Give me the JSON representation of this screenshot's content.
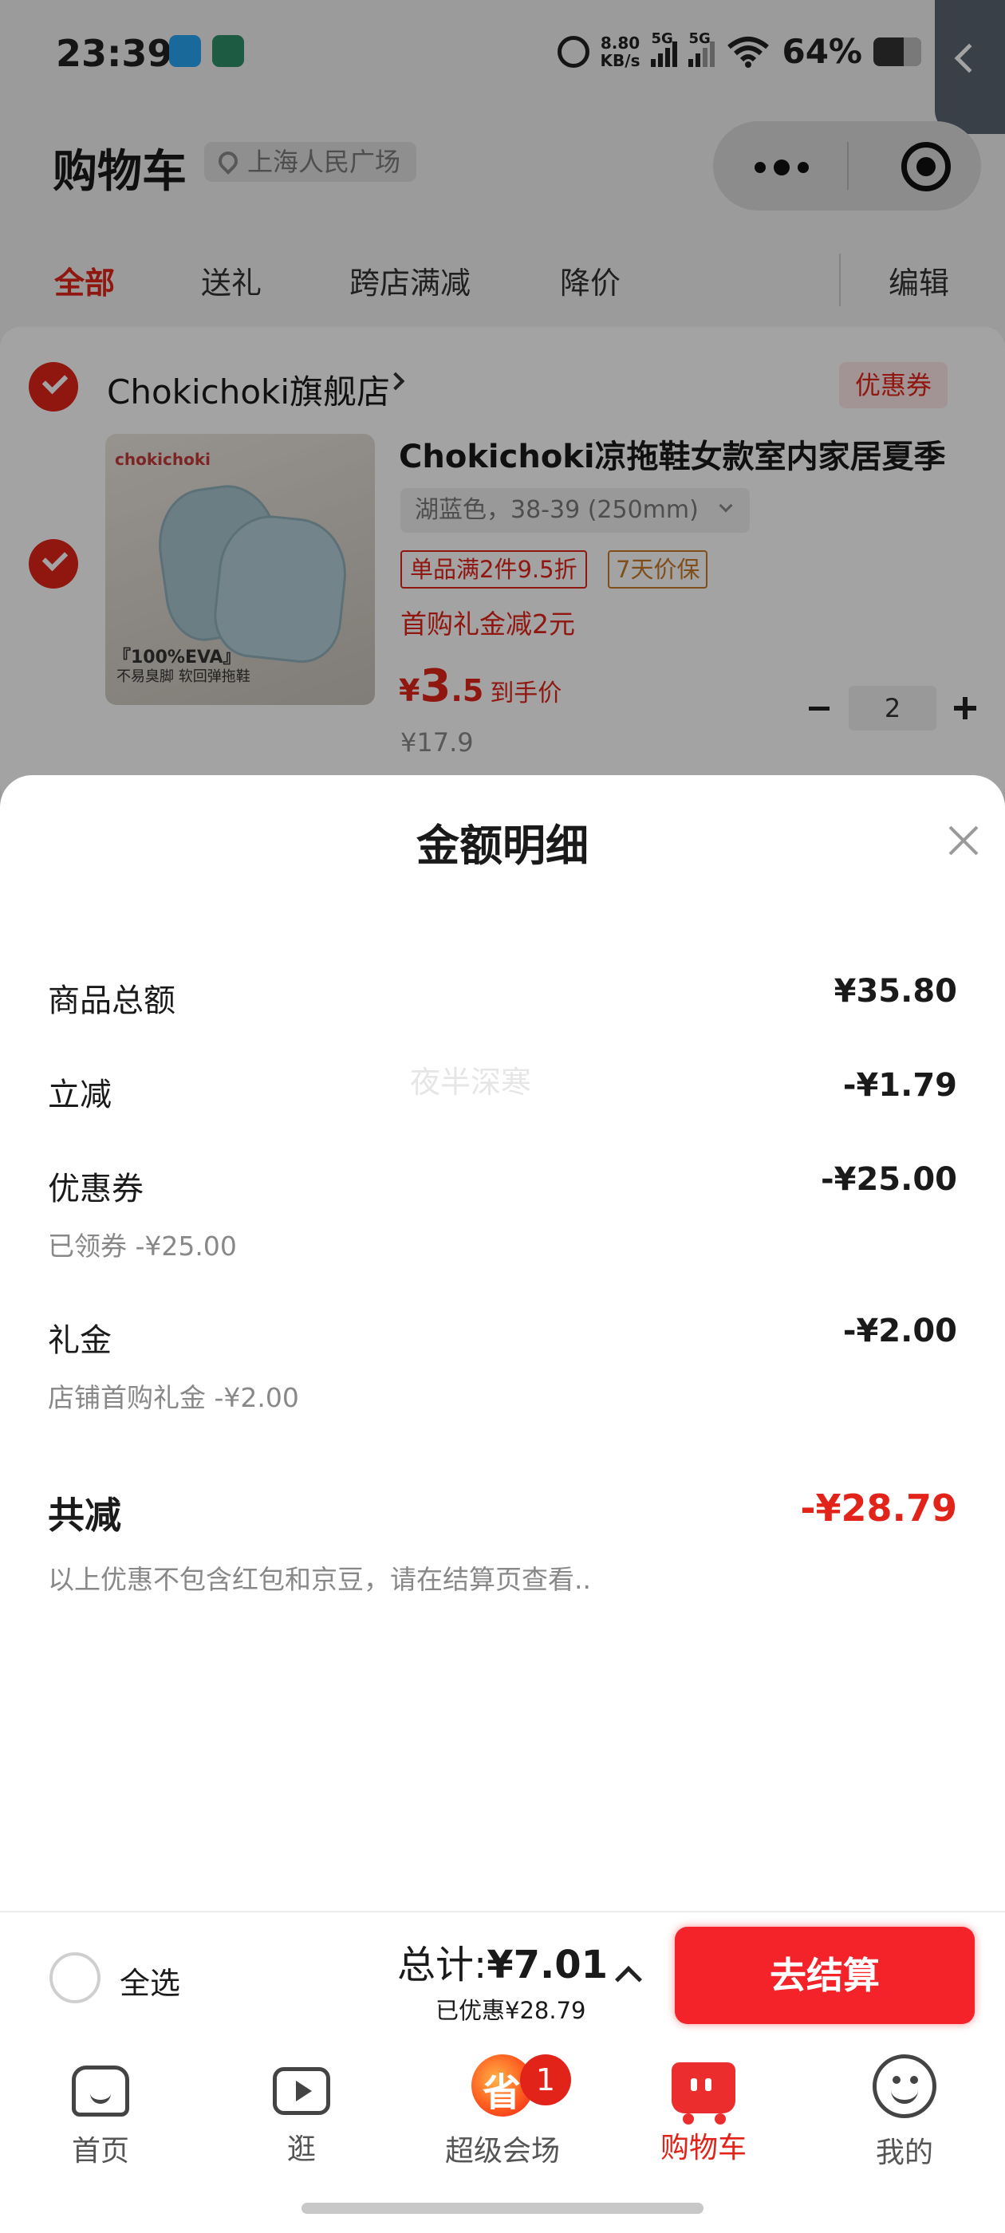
{
  "status_bar": {
    "time": "23:39",
    "net_speed_value": "8.80",
    "net_speed_unit": "KB/s",
    "sig1_label": "5G",
    "sig2_label": "5G",
    "battery": "64%"
  },
  "header": {
    "title": "购物车",
    "location": "上海人民广场"
  },
  "tabs": [
    {
      "label": "全部"
    },
    {
      "label": "送礼"
    },
    {
      "label": "跨店满减"
    },
    {
      "label": "降价"
    }
  ],
  "edit_label": "编辑",
  "cart": {
    "shop_name": "Chokichoki旗舰店",
    "coupon_label": "优惠券",
    "product": {
      "image_brand": "chokichoki",
      "image_tag1": "『100%EVA』",
      "image_tag2": "不易臭脚 软回弹拖鞋",
      "title": "Chokichoki凉拖鞋女款室内家居夏季",
      "sku": "湖蓝色，38-39 (250mm)",
      "promo1": "单品满2件9.5折",
      "promo2": "7天价保",
      "gift": "首购礼金减2元",
      "price_yen": "¥",
      "price_int": "3",
      "price_dec": ".5",
      "price_suffix": "到手价",
      "original_price": "¥17.9",
      "quantity": "2"
    }
  },
  "sheet": {
    "title": "金额明细",
    "watermark": "夜半深寒",
    "rows": [
      {
        "label": "商品总额",
        "value": "¥35.80",
        "sub": ""
      },
      {
        "label": "立减",
        "value": "-¥1.79",
        "sub": ""
      },
      {
        "label": "优惠券",
        "value": "-¥25.00",
        "sub": "已领券 -¥25.00"
      },
      {
        "label": "礼金",
        "value": "-¥2.00",
        "sub": "店铺首购礼金 -¥2.00"
      }
    ],
    "total_label": "共减",
    "total_value": "-¥28.79",
    "note": "以上优惠不包含红包和京豆，请在结算页查看.."
  },
  "checkout": {
    "select_all": "全选",
    "total_prefix": "总计:",
    "total_amount": "¥7.01",
    "saved": "已优惠¥28.79",
    "button": "去结算"
  },
  "nav": {
    "items": [
      {
        "label": "首页",
        "icon": "home-icon"
      },
      {
        "label": "逛",
        "icon": "video-icon"
      },
      {
        "label": "超级会场",
        "icon": "super-venue-icon"
      },
      {
        "label": "购物车",
        "icon": "cart-icon"
      },
      {
        "label": "我的",
        "icon": "profile-icon"
      }
    ],
    "badge": "1"
  },
  "colors": {
    "accent": "#e2231a",
    "checkout_button": "#f4232a",
    "price_guard": "#c87a2a"
  }
}
